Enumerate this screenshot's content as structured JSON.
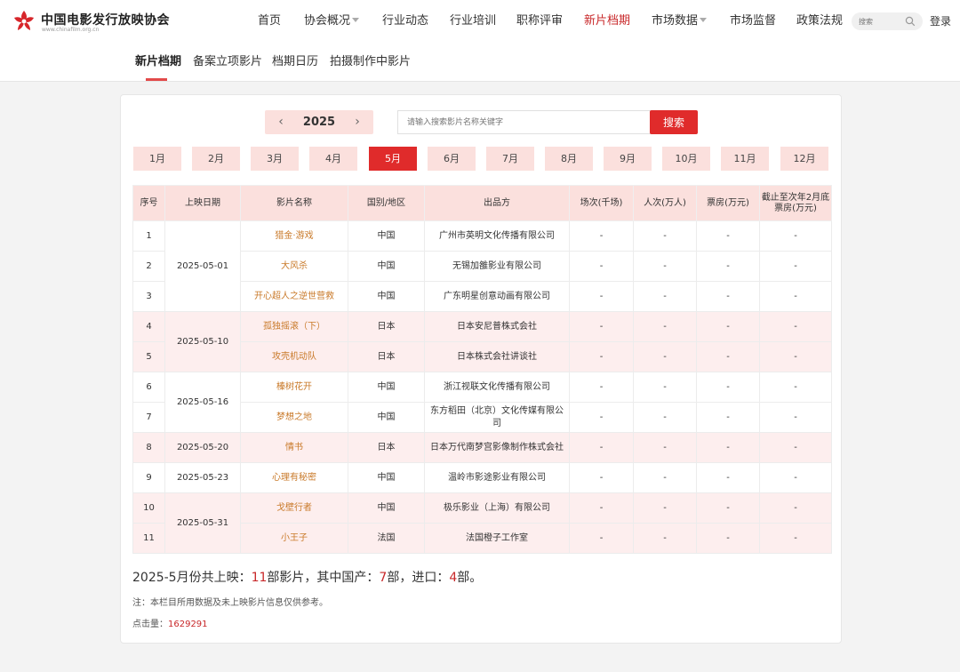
{
  "header": {
    "logo_title": "中国电影发行放映协会",
    "logo_url": "www.chinafilm.org.cn",
    "nav": [
      {
        "label": "首页"
      },
      {
        "label": "协会概况"
      },
      {
        "label": "行业动态"
      },
      {
        "label": "行业培训"
      },
      {
        "label": "职称评审"
      },
      {
        "label": "新片档期"
      },
      {
        "label": "市场数据"
      },
      {
        "label": "市场监督"
      },
      {
        "label": "政策法规"
      }
    ],
    "search_placeholder": "搜索",
    "login": "登录",
    "accent_color": "#c8282a"
  },
  "subnav": [
    "新片档期",
    "备案立项影片",
    "档期日历",
    "拍摄制作中影片"
  ],
  "filters": {
    "year": "2025",
    "search_placeholder": "请输入搜索影片名称关键字",
    "search_button": "搜索",
    "months": [
      "1月",
      "2月",
      "3月",
      "4月",
      "5月",
      "6月",
      "7月",
      "8月",
      "9月",
      "10月",
      "11月",
      "12月"
    ],
    "active_month": "5月"
  },
  "table": {
    "headers": [
      "序号",
      "上映日期",
      "影片名称",
      "国别/地区",
      "出品方",
      "场次(千场)",
      "人次(万人)",
      "票房(万元)",
      "截止至次年2月底票房(万元)"
    ],
    "dates": [
      "2025-05-01",
      "2025-05-10",
      "2025-05-16",
      "2025-05-20",
      "2025-05-23",
      "2025-05-31"
    ],
    "rows": [
      {
        "no": "1",
        "film": "猎金·游戏",
        "region": "中国",
        "producer": "广州市英明文化传播有限公司",
        "shows": "-",
        "admissions": "-",
        "boxoffice": "-",
        "total": "-"
      },
      {
        "no": "2",
        "film": "大风杀",
        "region": "中国",
        "producer": "无锡加雒影业有限公司",
        "shows": "-",
        "admissions": "-",
        "boxoffice": "-",
        "total": "-"
      },
      {
        "no": "3",
        "film": "开心超人之逆世营救",
        "region": "中国",
        "producer": "广东明星创意动画有限公司",
        "shows": "-",
        "admissions": "-",
        "boxoffice": "-",
        "total": "-"
      },
      {
        "no": "4",
        "film": "孤独摇滚（下）",
        "region": "日本",
        "producer": "日本安尼普株式会社",
        "shows": "-",
        "admissions": "-",
        "boxoffice": "-",
        "total": "-"
      },
      {
        "no": "5",
        "film": "攻壳机动队",
        "region": "日本",
        "producer": "日本株式会社讲谈社",
        "shows": "-",
        "admissions": "-",
        "boxoffice": "-",
        "total": "-"
      },
      {
        "no": "6",
        "film": "榛树花开",
        "region": "中国",
        "producer": "浙江视联文化传播有限公司",
        "shows": "-",
        "admissions": "-",
        "boxoffice": "-",
        "total": "-"
      },
      {
        "no": "7",
        "film": "梦想之地",
        "region": "中国",
        "producer": "东方稻田（北京）文化传媒有限公司",
        "shows": "-",
        "admissions": "-",
        "boxoffice": "-",
        "total": "-"
      },
      {
        "no": "8",
        "film": "情书",
        "region": "日本",
        "producer": "日本万代南梦宫影像制作株式会社",
        "shows": "-",
        "admissions": "-",
        "boxoffice": "-",
        "total": "-"
      },
      {
        "no": "9",
        "film": "心理有秘密",
        "region": "中国",
        "producer": "温岭市影途影业有限公司",
        "shows": "-",
        "admissions": "-",
        "boxoffice": "-",
        "total": "-"
      },
      {
        "no": "10",
        "film": "戈壁行者",
        "region": "中国",
        "producer": "极乐影业（上海）有限公司",
        "shows": "-",
        "admissions": "-",
        "boxoffice": "-",
        "total": "-"
      },
      {
        "no": "11",
        "film": "小王子",
        "region": "法国",
        "producer": "法国橙子工作室",
        "shows": "-",
        "admissions": "-",
        "boxoffice": "-",
        "total": "-"
      }
    ]
  },
  "summary": {
    "prefix": "2025-5月份共上映：",
    "total": "11",
    "mid1": "部影片，其中国产：",
    "domestic": "7",
    "mid2": "部，进口：",
    "imported": "4",
    "suffix": "部。"
  },
  "note": "注：本栏目所用数据及未上映影片信息仅供参考。",
  "clicks": {
    "label": "点击量：",
    "value": "1629291"
  }
}
